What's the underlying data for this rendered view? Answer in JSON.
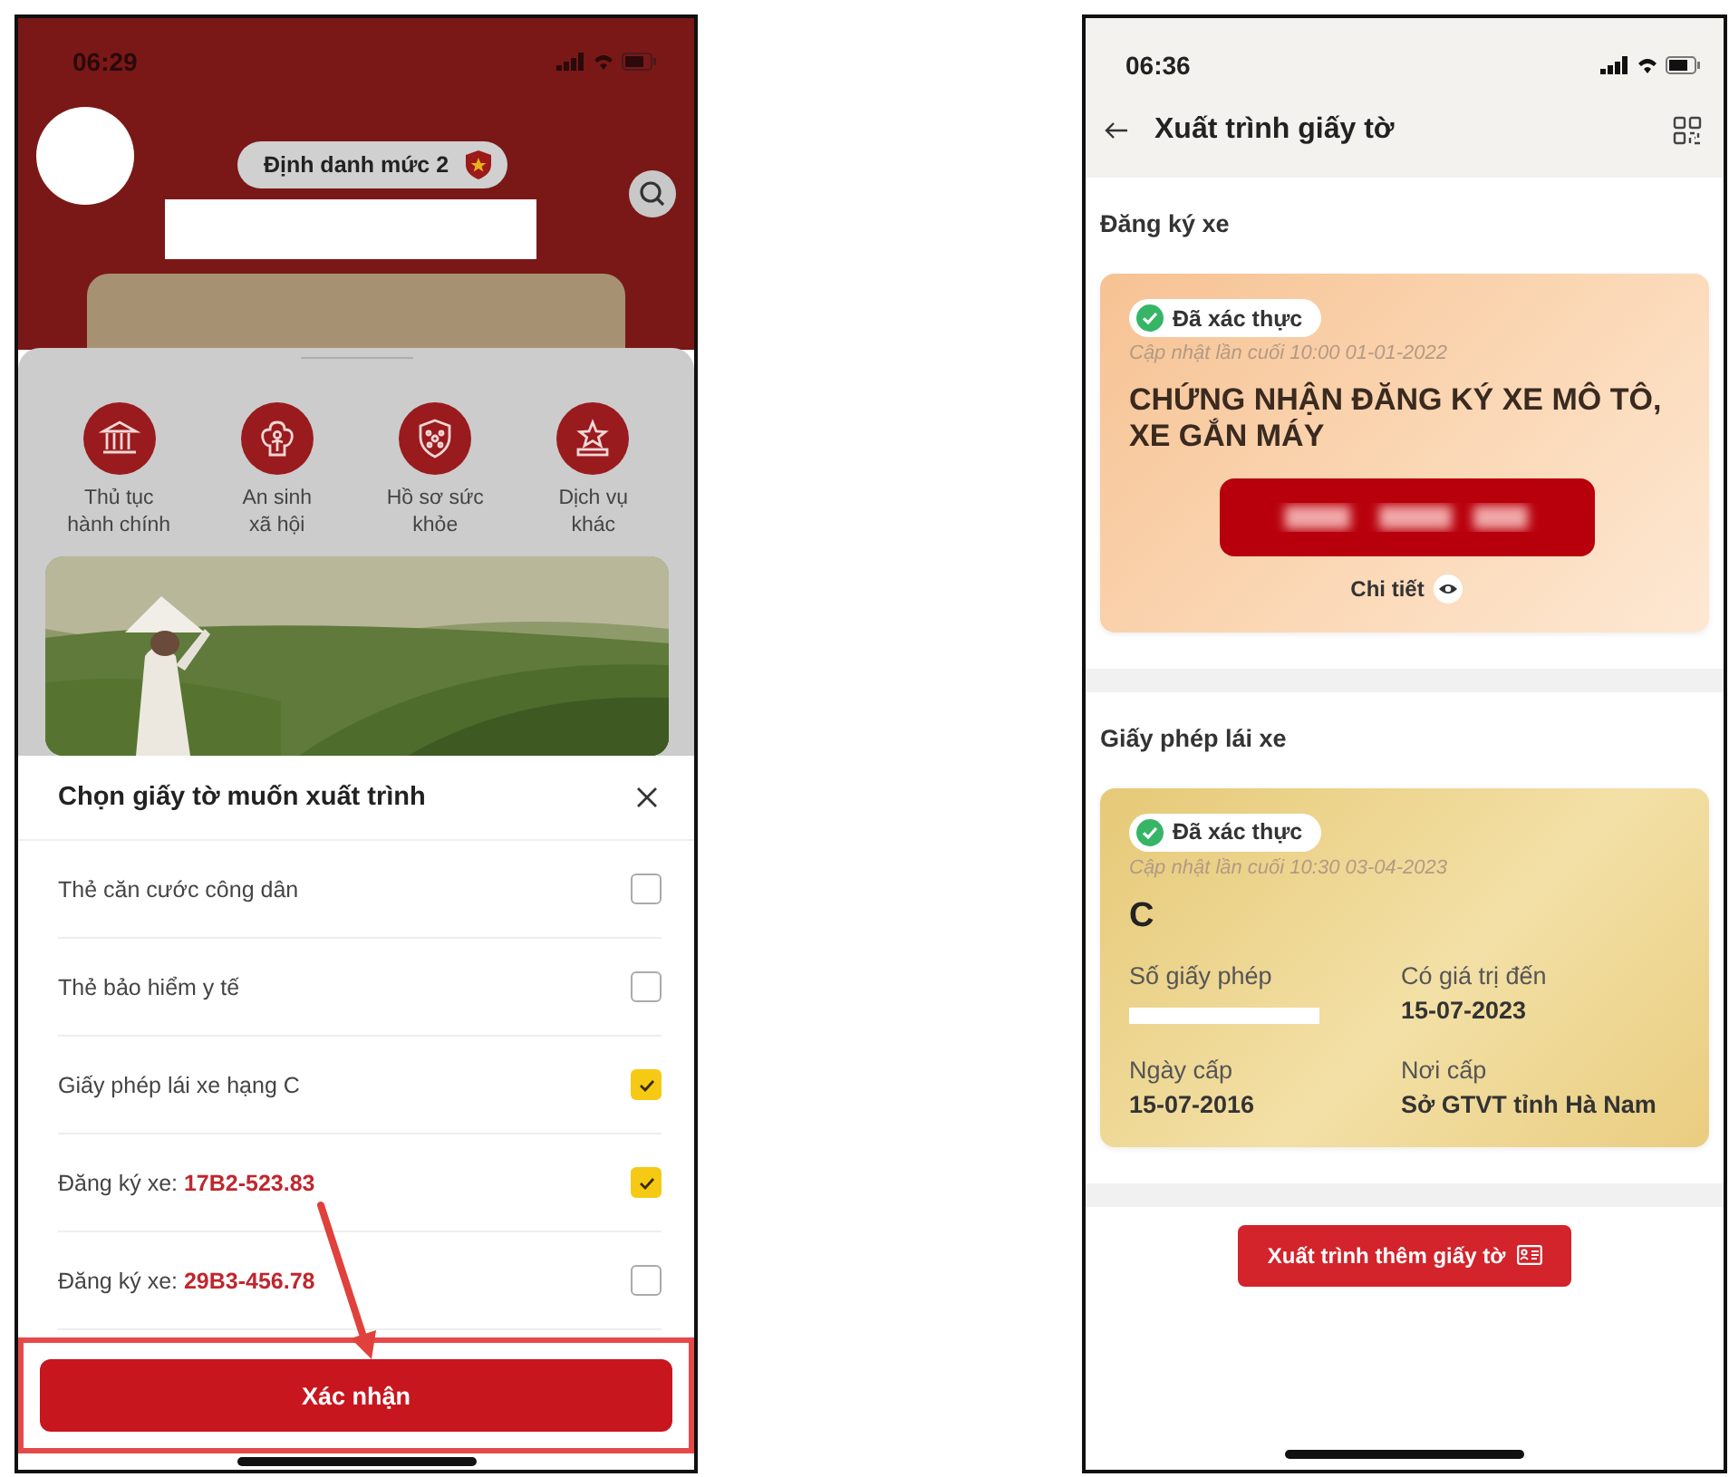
{
  "left_screen": {
    "status_bar": {
      "time": "06:29"
    },
    "profile": {
      "level_badge": "Định danh mức 2"
    },
    "services": [
      {
        "kind": "procedures",
        "label": "Thủ tục\nhành chính"
      },
      {
        "kind": "social",
        "label": "An sinh\nxã hội"
      },
      {
        "kind": "health",
        "label": "Hồ sơ sức\nkhỏe"
      },
      {
        "kind": "other",
        "label": "Dịch vụ\nkhác"
      }
    ],
    "sheet": {
      "title": "Chọn giấy tờ muốn xuất trình",
      "options": [
        {
          "label": "Thẻ căn cước công dân",
          "checked": false
        },
        {
          "label": "Thẻ bảo hiểm y tế",
          "checked": false
        },
        {
          "label": "Giấy phép lái xe hạng C",
          "checked": true
        },
        {
          "label": "Đăng ký xe: **17B2-523.83**",
          "checked": true
        },
        {
          "label": "Đăng ký xe: **29B3-456.78**",
          "checked": false
        }
      ],
      "confirm_button": "Xác nhận"
    }
  },
  "right_screen": {
    "status_bar": {
      "time": "06:36"
    },
    "header": {
      "title": "Xuất trình giấy tờ"
    },
    "sections": [
      {
        "heading": "Đăng ký xe",
        "card": {
          "kind": "registration",
          "verified_badge": "Đã xác thực",
          "updated": "Cập nhật lần cuối 10:00 01-01-2022",
          "title": "CHỨNG NHẬN ĐĂNG KÝ XE MÔ TÔ, XE GẮN MÁY",
          "details_link": "Chi tiết"
        }
      },
      {
        "heading": "Giấy phép lái xe",
        "card": {
          "kind": "license",
          "verified_badge": "Đã xác thực",
          "updated": "Cập nhật lần cuối 10:30 03-04-2023",
          "title": "C",
          "fields": [
            {
              "label": "Số giấy phép"
            },
            {
              "label": "Có giá trị đến",
              "value": "15-07-2023"
            },
            {
              "label": "Ngày cấp",
              "value": "15-07-2016"
            },
            {
              "label": "Nơi cấp",
              "value": "Sở GTVT tỉnh Hà Nam"
            }
          ]
        }
      }
    ],
    "more_button": "Xuất trình thêm giấy tờ"
  }
}
